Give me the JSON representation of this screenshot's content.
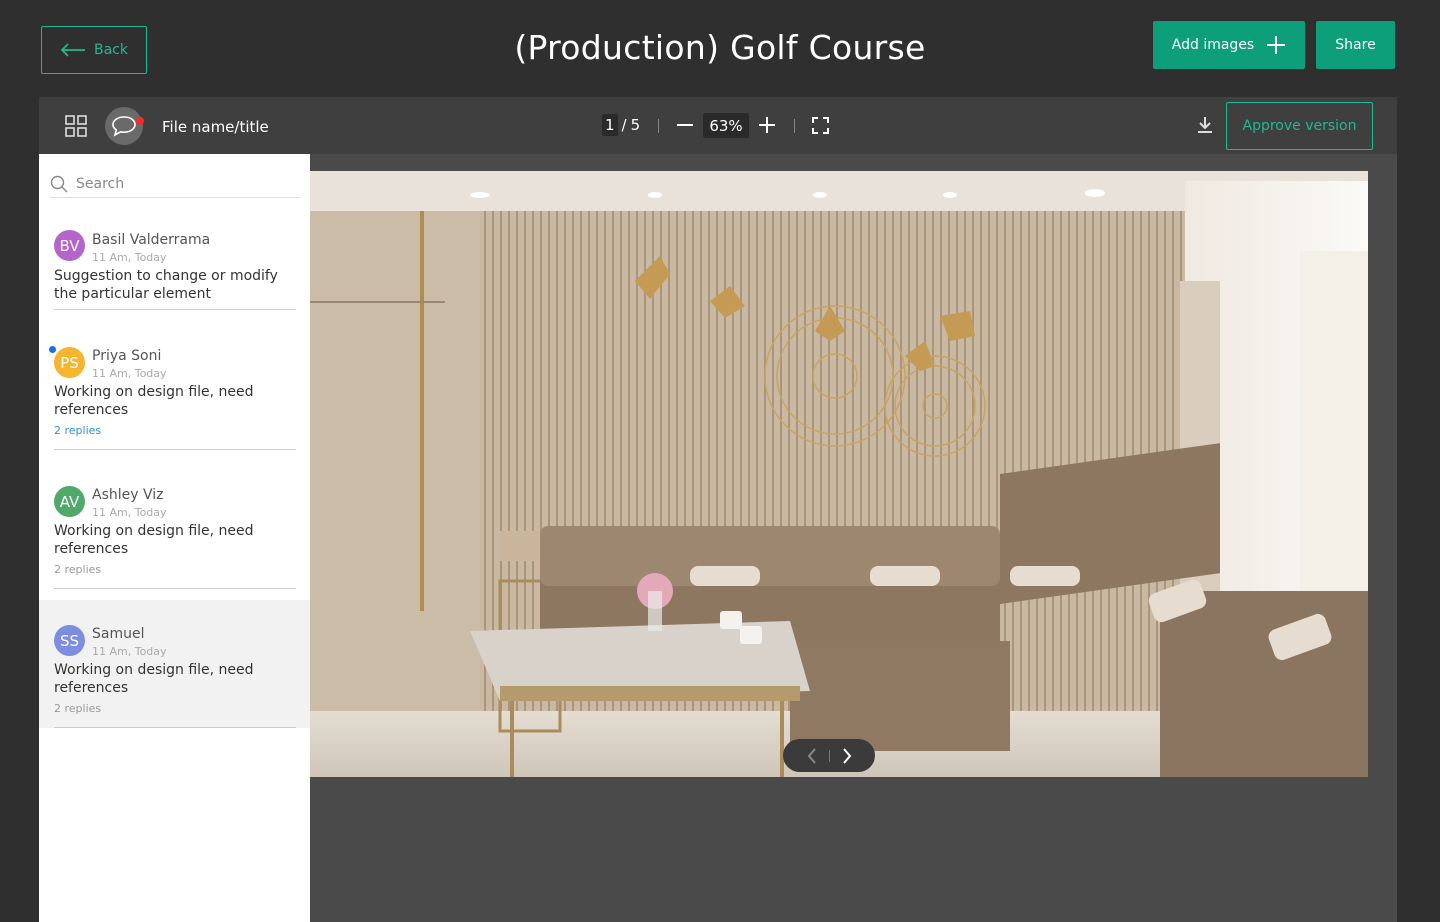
{
  "header": {
    "back_label": "Back",
    "title": "(Production) Golf Course",
    "add_images_label": "Add images",
    "share_label": "Share"
  },
  "toolbar": {
    "file_title": "File name/title",
    "current_page": "1",
    "page_separator": "/",
    "total_pages": "5",
    "zoom": "63%",
    "approve_label": "Approve version"
  },
  "search": {
    "placeholder": "Search"
  },
  "comments": [
    {
      "initials": "BV",
      "name": "Basil Valderrama",
      "time": "11 Am, Today",
      "text": "Suggestion to change or modify the particular element",
      "replies": "",
      "avatar_color": "#b565c9",
      "unread": false
    },
    {
      "initials": "PS",
      "name": "Priya Soni",
      "time": "11 Am, Today",
      "text": "Working on design file, need references",
      "replies": "2 replies",
      "avatar_color": "#f5b52e",
      "unread": true
    },
    {
      "initials": "AV",
      "name": "Ashley Viz",
      "time": "11 Am, Today",
      "text": "Working on design file, need references",
      "replies": "2 replies",
      "avatar_color": "#4fa96a",
      "unread": false
    },
    {
      "initials": "SS",
      "name": "Samuel",
      "time": "11 Am, Today",
      "text": "Working on design file, need references",
      "replies": "2 replies",
      "avatar_color": "#7d8de0",
      "unread": false
    }
  ],
  "colors": {
    "accent": "#0d9e7a",
    "accent_outline": "#1db992",
    "unread_dot": "#1a6ee8",
    "notification_dot": "#ff2a2a"
  },
  "icons": [
    "arrow-left-icon",
    "plus-icon",
    "grid-icon",
    "chat-bubble-icon",
    "minus-icon",
    "fullscreen-icon",
    "download-icon",
    "search-icon",
    "chevron-left-icon",
    "chevron-right-icon"
  ]
}
